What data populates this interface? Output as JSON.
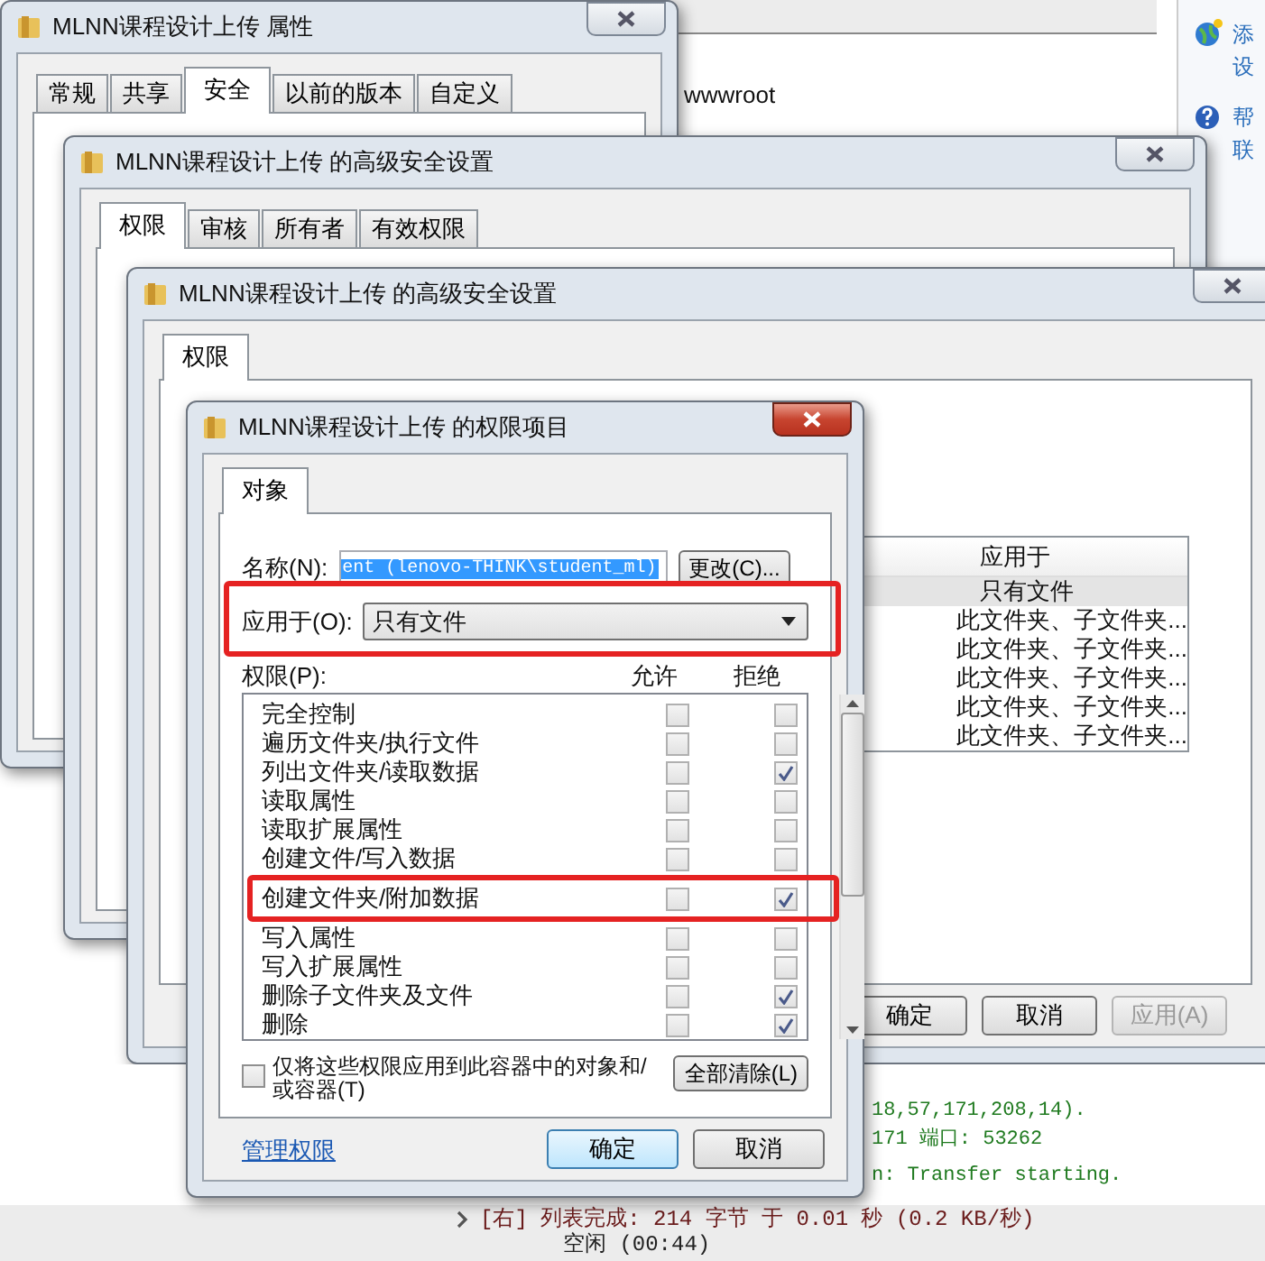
{
  "explorer": {
    "file_item": "wwwroot",
    "side_links": [
      {
        "lines": [
          "添",
          "设"
        ]
      },
      {
        "lines": [
          "帮",
          "联"
        ]
      }
    ]
  },
  "properties_window": {
    "title": "MLNN课程设计上传 属性",
    "tabs": [
      {
        "label": "常规",
        "selected": false
      },
      {
        "label": "共享",
        "selected": false
      },
      {
        "label": "安全",
        "selected": true
      },
      {
        "label": "以前的版本",
        "selected": false
      },
      {
        "label": "自定义",
        "selected": false
      }
    ]
  },
  "advanced_window": {
    "title": "MLNN课程设计上传 的高级安全设置",
    "tabs": [
      {
        "label": "权限",
        "selected": true
      },
      {
        "label": "审核",
        "selected": false
      },
      {
        "label": "所有者",
        "selected": false
      },
      {
        "label": "有效权限",
        "selected": false
      }
    ]
  },
  "advanced_edit_window": {
    "title": "MLNN课程设计上传 的高级安全设置",
    "tabs": [
      {
        "label": "权限",
        "selected": true
      }
    ],
    "table": {
      "columns": [
        "应用于"
      ],
      "rows": [
        {
          "apply_to": "只有文件",
          "selected": true
        },
        {
          "apply_to": "此文件夹、子文件夹...",
          "selected": false
        },
        {
          "apply_to": "此文件夹、子文件夹...",
          "selected": false
        },
        {
          "apply_to": "此文件夹、子文件夹...",
          "selected": false
        },
        {
          "apply_to": "此文件夹、子文件夹...",
          "selected": false
        },
        {
          "apply_to": "此文件夹、子文件夹...",
          "selected": false
        }
      ]
    },
    "buttons": [
      {
        "label": "确定",
        "disabled": false
      },
      {
        "label": "取消",
        "disabled": false
      },
      {
        "label": "应用(A)",
        "disabled": true
      }
    ]
  },
  "entry_dialog": {
    "title": "MLNN课程设计上传 的权限项目",
    "tabs": [
      {
        "label": "对象",
        "selected": true
      }
    ],
    "name_label": "名称(N):",
    "name_value": "ent (lenovo-THINK\\student_ml)",
    "name_value_selected": true,
    "change_button": "更改(C)...",
    "apply_label": "应用于(O):",
    "apply_value": "只有文件",
    "apply_highlighted": true,
    "permissions_label": "权限(P):",
    "allow_label": "允许",
    "deny_label": "拒绝",
    "permissions": [
      {
        "name": "完全控制",
        "allow": false,
        "deny": false,
        "highlighted": false
      },
      {
        "name": "遍历文件夹/执行文件",
        "allow": false,
        "deny": false,
        "highlighted": false
      },
      {
        "name": "列出文件夹/读取数据",
        "allow": false,
        "deny": true,
        "highlighted": false
      },
      {
        "name": "读取属性",
        "allow": false,
        "deny": false,
        "highlighted": false
      },
      {
        "name": "读取扩展属性",
        "allow": false,
        "deny": false,
        "highlighted": false
      },
      {
        "name": "创建文件/写入数据",
        "allow": false,
        "deny": false,
        "highlighted": false
      },
      {
        "name": "创建文件夹/附加数据",
        "allow": false,
        "deny": true,
        "highlighted": true
      },
      {
        "name": "写入属性",
        "allow": false,
        "deny": false,
        "highlighted": false
      },
      {
        "name": "写入扩展属性",
        "allow": false,
        "deny": false,
        "highlighted": false
      },
      {
        "name": "删除子文件夹及文件",
        "allow": false,
        "deny": true,
        "highlighted": false
      },
      {
        "name": "删除",
        "allow": false,
        "deny": true,
        "highlighted": false
      }
    ],
    "container_only": {
      "label": "仅将这些权限应用到此容器中的对象和/或容器(T)",
      "checked": false
    },
    "clear_button": "全部清除(L)",
    "manage_link": "管理权限",
    "buttons": [
      {
        "label": "确定",
        "default": true
      },
      {
        "label": "取消",
        "default": false
      }
    ]
  },
  "log": {
    "lines": [
      "18,57,171,208,14).",
      "171 端口: 53262",
      "n: Transfer starting."
    ]
  },
  "status_bar": {
    "lines": [
      "[右] 列表完成: 214 字节 于 0.01 秒 (0.2 KB/秒)",
      "空闲 (00:44)"
    ]
  }
}
